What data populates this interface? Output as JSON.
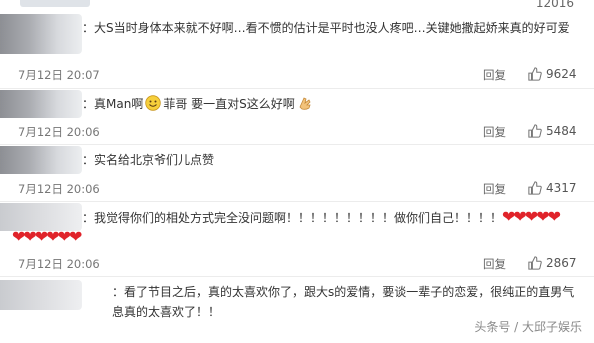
{
  "top_partial": {
    "count": "12016"
  },
  "comments": [
    {
      "text": "：大S当时身体本来就不好啊…看不惯的估计是平时也没人疼吧…关键她撒起娇来真的好可爱",
      "date": "7月12日 20:07",
      "reply": "回复",
      "likes": "9624"
    },
    {
      "text_a": "：真Man啊",
      "text_b": "菲哥 要一直对S这么好啊",
      "date": "7月12日 20:06",
      "reply": "回复",
      "likes": "5484"
    },
    {
      "text": "：实名给北京爷们儿点赞",
      "date": "7月12日 20:06",
      "reply": "回复",
      "likes": "4317"
    },
    {
      "text": "：我觉得你们的相处方式完全没问题啊！！！！！！！！！做你们自己！！！！",
      "date": "7月12日 20:06",
      "reply": "回复",
      "likes": "2867"
    },
    {
      "text": "：看了节目之后，真的太喜欢你了，跟大s的爱情，要谈一辈子的恋爱，很纯正的直男气息真的太喜欢了！！"
    }
  ],
  "hearts_line1": "❤❤❤❤❤",
  "hearts_line2": "❤❤❤❤❤❤",
  "watermark": "头条号 / 大邱子娱乐",
  "colors": {
    "heart": "#e0232a",
    "text": "#333333",
    "meta": "#777777"
  },
  "icons": {
    "like": "thumbs-up-icon",
    "smile": "smile-emoji",
    "clap": "clap-emoji"
  }
}
